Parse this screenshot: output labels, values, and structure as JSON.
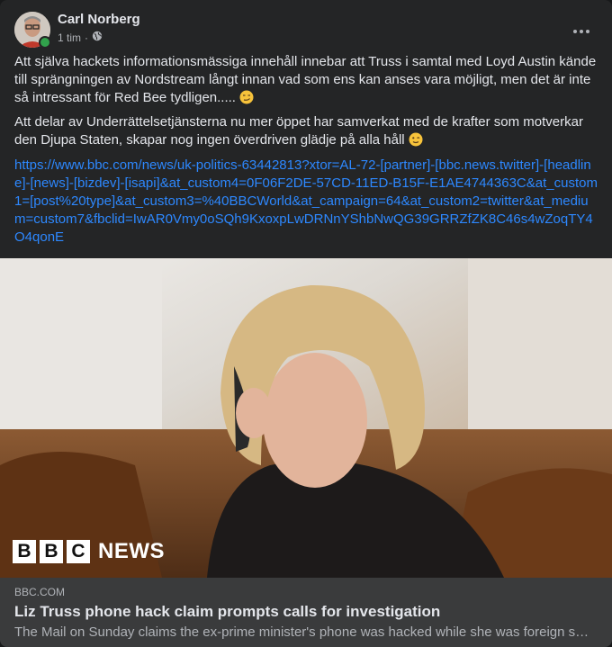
{
  "post": {
    "author": "Carl Norberg",
    "time": "1 tim",
    "separator": "·",
    "privacy_icon": "globe-icon",
    "more_icon": "more-horizontal-icon",
    "paragraph1": "Att själva hackets informationsmässiga innehåll innebar att Truss i samtal med Loyd Austin kände till sprängningen av Nordstream långt innan vad som ens kan anses vara möjligt, men det är inte så intressant för Red Bee tydligen.....",
    "paragraph1_emoji": "smirk-emoji",
    "paragraph2": "Att delar av Underrättelsetjänsterna nu mer öppet har samverkat med de krafter som motverkar den Djupa Staten, skapar nog ingen överdriven glädje på alla håll",
    "paragraph2_emoji": "wink-emoji",
    "link": "https://www.bbc.com/news/uk-politics-63442813?xtor=AL-72-[partner]-[bbc.news.twitter]-[headline]-[news]-[bizdev]-[isapi]&at_custom4=0F06F2DE-57CD-11ED-B15F-E1AE4744363C&at_custom1=[post%20type]&at_custom3=%40BBCWorld&at_campaign=64&at_custom2=twitter&at_medium=custom7&fbclid=IwAR0Vmy0oSQh9KxoxpLwDRNnYShbNwQG39GRRZfZK8C46s4wZoqTY4O4qonE"
  },
  "image": {
    "logo_letters": [
      "B",
      "B",
      "C"
    ],
    "logo_word": "NEWS"
  },
  "preview": {
    "domain": "BBC.COM",
    "title": "Liz Truss phone hack claim prompts calls for investigation",
    "description": "The Mail on Sunday claims the ex-prime minister's phone was hacked while she was foreign secretary."
  },
  "colors": {
    "card_bg": "#242526",
    "preview_bg": "#3a3b3c",
    "link": "#2d88ff",
    "online": "#31a24c"
  }
}
